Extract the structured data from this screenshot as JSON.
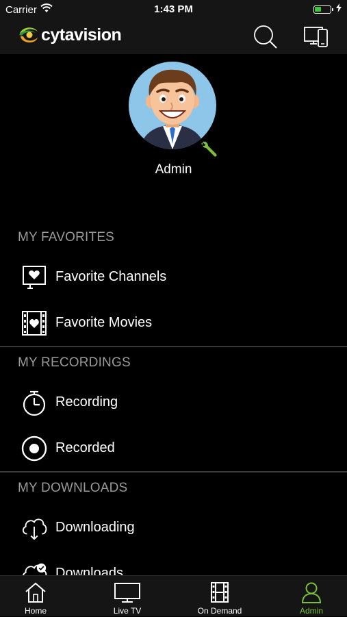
{
  "status_bar": {
    "carrier": "Carrier",
    "time": "1:43 PM"
  },
  "app": {
    "logo_text": "cytavision",
    "brand_color": "#7bbf3a"
  },
  "profile": {
    "username": "Admin"
  },
  "sections": [
    {
      "header": "MY FAVORITES",
      "items": [
        {
          "label": "Favorite Channels",
          "icon": "tv-heart-icon"
        },
        {
          "label": "Favorite Movies",
          "icon": "film-heart-icon"
        }
      ]
    },
    {
      "header": "MY RECORDINGS",
      "items": [
        {
          "label": "Recording",
          "icon": "timer-icon"
        },
        {
          "label": "Recorded",
          "icon": "record-icon"
        }
      ]
    },
    {
      "header": "MY DOWNLOADS",
      "items": [
        {
          "label": "Downloading",
          "icon": "cloud-download-icon"
        },
        {
          "label": "Downloads",
          "icon": "cloud-check-icon"
        }
      ]
    }
  ],
  "tabs": [
    {
      "label": "Home",
      "icon": "home-icon"
    },
    {
      "label": "Live TV",
      "icon": "tv-icon"
    },
    {
      "label": "On Demand",
      "icon": "film-icon"
    },
    {
      "label": "Admin",
      "icon": "user-icon",
      "active": true
    }
  ]
}
